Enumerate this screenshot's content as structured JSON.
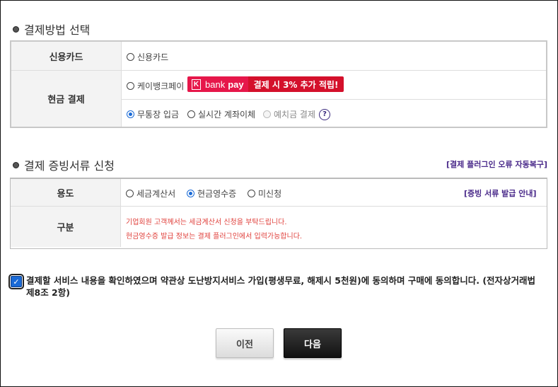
{
  "payment_method": {
    "title": "결제방법 선택",
    "card_label": "신용카드",
    "card_option": "신용카드",
    "cash_label": "현금 결제",
    "kbank_option": "케이뱅크페이",
    "kbank_badge": {
      "k": "K",
      "bank": "bank",
      "pay": "pay",
      "promo": "결제 시 3% 추가 적립!"
    },
    "bank_transfer": "무통장 입금",
    "realtime_transfer": "실시간 계좌이체",
    "escrow": "예치금 결제",
    "help_icon": "?",
    "selected": "무통장 입금"
  },
  "docs": {
    "title": "결제 증빙서류 신청",
    "plugin_link": "[결제 플러그인 오류 자동복구]",
    "usage_label": "용도",
    "opt_tax": "세금계산서",
    "opt_cash": "현금영수증",
    "opt_none": "미신청",
    "selected": "현금영수증",
    "guide_link": "[증빙 서류 발급 안내]",
    "type_label": "구분",
    "notice_1": "기업회원 고객께서는 세금계산서 신청을 부탁드립니다.",
    "notice_2": "현금영수증 발급 정보는 결제 플러그인에서 입력가능합니다."
  },
  "agreement": {
    "checked": true,
    "check_mark": "✓",
    "text": "결제할 서비스 내용을 확인하였으며 약관상 도난방지서비스 가입(평생무료, 해제시 5천원)에 동의하며 구매에 동의합니다. (전자상거래법 제8조 2항)"
  },
  "buttons": {
    "prev": "이전",
    "next": "다음"
  },
  "colors": {
    "accent_blue": "#1a6ad6",
    "promo_red": "#e6174a",
    "notice_red": "#e0413c",
    "link_purple": "#4a2a8a"
  }
}
